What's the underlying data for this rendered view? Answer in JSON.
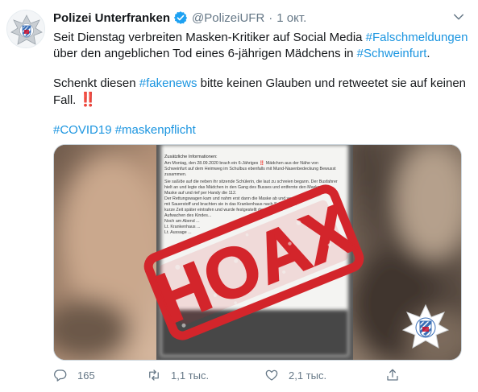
{
  "tweet": {
    "author_name": "Polizei Unterfranken",
    "handle": "@PolizeiUFR",
    "separator": "·",
    "time": "1 окт.",
    "text": {
      "line1_prefix": "Seit Dienstag verbreiten Masken-Kritiker auf Social Media ",
      "line1_tag": "#Falschmeldungen",
      "line2_prefix": "über den angeblichen Tod eines 6-jährigen Mädchens in ",
      "line2_tag": "#Schweinfurt",
      "line2_suffix": ".",
      "para2_prefix": "Schenkt diesen ",
      "para2_tag": "#fakenews",
      "para2_suffix": " bitte keinen Glauben und retweetet sie auf keinen",
      "para2_line2": "Fall. ",
      "para2_emoji": "‼️",
      "hashtag1": "#COVID19",
      "hashtag2": "#maskenpflicht"
    },
    "media": {
      "stamp_text": "HOAX",
      "doc_heading": "Zusätzliche Informationen:",
      "doc_lines": [
        "Am Montag, den 28.09.2020 brach ein 6-Jähriges ‼️ Mädchen aus der Nähe von",
        "Schweinfurt auf dem Heimweg im Schulbus ebenfalls mit Mund-Nasenbedeckung Bewusst",
        "zusammen.",
        "Sie saß/de auf die neben ihr sitzende Schülerin, die laut zu schreien begann. Der Busfahrer",
        "hielt an und legte das Mädchen in den Gang des Busses und entfernte den Masken",
        "Maske auf und rief per Handy die 112.",
        "Der Rettungswagen kam und nahm erst dann die Maske ab und versorgte",
        "mit Sauerstoff und brachten sie in das Krankenhaus nach Schweinfurt",
        "kurze Zeit später eintrafen und wurde festgestellt das das Kind",
        "Aufwachen des Kindes...",
        "Noch am Abend ...",
        "Lt. Krankenhaus ...",
        "Lt. Aussage ..."
      ]
    },
    "actions": {
      "reply_count": "165",
      "retweet_count": "1,1 тыс.",
      "like_count": "2,1 тыс."
    }
  },
  "colors": {
    "link": "#1b95e0",
    "verified": "#1da1f2",
    "secondary_text": "#657786",
    "stamp_red": "#d3252b"
  }
}
